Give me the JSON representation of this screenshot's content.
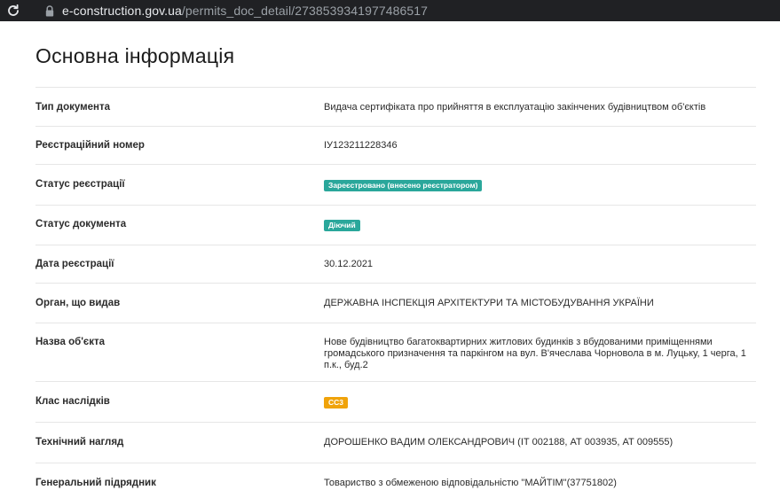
{
  "browser": {
    "url_host": "e-construction.gov.ua",
    "url_path": "/permits_doc_detail/2738539341977486517"
  },
  "page": {
    "title": "Основна інформація"
  },
  "rows": [
    {
      "label": "Тип документа",
      "value": "Видача сертифіката про прийняття в експлуатацію закінчених будівництвом об'єктів"
    },
    {
      "label": "Реєстраційний номер",
      "value": "ІУ123211228346"
    },
    {
      "label": "Статус реєстрації",
      "value": "Зареєстровано (внесено реєстратором)"
    },
    {
      "label": "Статус документа",
      "value": "Діючий"
    },
    {
      "label": "Дата реєстрації",
      "value": "30.12.2021"
    },
    {
      "label": "Орган, що видав",
      "value": "ДЕРЖАВНА ІНСПЕКЦІЯ АРХІТЕКТУРИ ТА МІСТОБУДУВАННЯ УКРАЇНИ"
    },
    {
      "label": "Назва об'єкта",
      "value": "Нове будівництво багатоквартирних житлових будинків з вбудованими приміщеннями громадського призначення та паркінгом на вул. В'ячеслава Чорновола в м. Луцьку, 1 черга, 1 п.к., буд.2"
    },
    {
      "label": "Клас наслідків",
      "value": "СС3"
    },
    {
      "label": "Технічний нагляд",
      "value": "ДОРОШЕНКО ВАДИМ ОЛЕКСАНДРОВИЧ (ІТ 002188, АТ 003935, АТ 009555)"
    },
    {
      "label": "Генеральний підрядник",
      "value": "Товариство з обмеженою відповідальністю \"МАЙТІМ\"(37751802)"
    }
  ],
  "colors": {
    "badge_green": "#2aa79b",
    "badge_orange": "#f0a30a",
    "browser_bar": "#202124"
  }
}
